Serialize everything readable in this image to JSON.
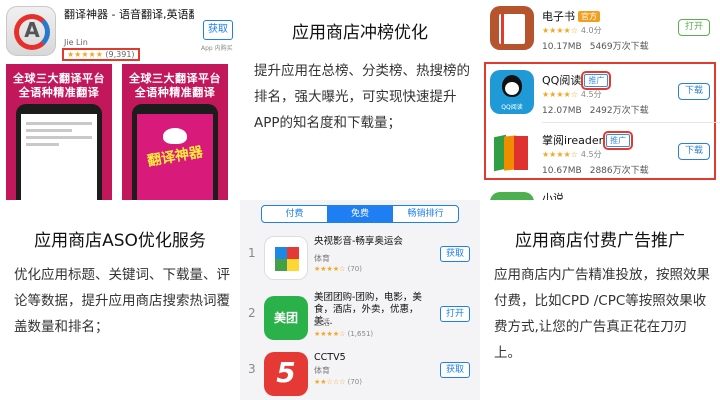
{
  "colors": {
    "accent_red": "#e23b2e",
    "ios_blue": "#1e7ef2",
    "shot_magenta": "#c2185b",
    "star": "#f5a623"
  },
  "app_listing": {
    "title": "翻译神器 - 语音翻译,英语翻译, 日语翻译,韩语翻译,泰语翻译,...",
    "developer": "Jie Lin",
    "rating_stars": "★★★★★",
    "rating_count": "(9,391)",
    "get_label": "获取",
    "iap_label": "App 内购买",
    "screenshots": [
      {
        "headline": "全球三大翻译平台 全语种精准翻译",
        "feature_text": ""
      },
      {
        "headline": "全球三大翻译平台 全语种精准翻译",
        "feature_text": "翻译神器"
      }
    ]
  },
  "section_rank": {
    "title": "应用商店冲榜优化",
    "body": "提升应用在总榜、分类榜、热搜榜的排名，强大曝光，可实现快速提升APP的知名度和下载量；"
  },
  "ad_list": [
    {
      "name": "电子书",
      "tag": "官方",
      "stars": "★★★★☆",
      "score": "4.0分",
      "size": "10.17MB",
      "downloads": "5469万次下载",
      "button": "打开"
    },
    {
      "name": "QQ阅读",
      "tag": "推广",
      "stars": "★★★★☆",
      "score": "4.5分",
      "size": "12.07MB",
      "downloads": "2492万次下载",
      "button": "下载"
    },
    {
      "name": "掌阅ireader",
      "tag": "推广",
      "stars": "★★★★☆",
      "score": "4.5分",
      "size": "10.67MB",
      "downloads": "2886万次下载",
      "button": "下载"
    },
    {
      "name": "小说",
      "tag": "",
      "stars": "",
      "score": "",
      "size": "",
      "downloads": "",
      "button": ""
    }
  ],
  "qq_icon_text": "QQ阅读",
  "section_aso": {
    "title": "应用商店ASO优化服务",
    "body": "优化应用标题、关键词、下载量、评论等数据，提升应用商店搜索热词覆盖数量和排名；"
  },
  "ranking": {
    "tabs": [
      "付费",
      "免费",
      "畅销排行"
    ],
    "active_tab": "免费",
    "items": [
      {
        "rank": "1",
        "name": "央视影音-畅享奥运会",
        "category": "体育",
        "stars": "★★★★☆",
        "reviews": "(70)",
        "button": "获取"
      },
      {
        "rank": "2",
        "name": "美团团购-团购，电影，美食，酒店，外卖，优惠，美...",
        "category": "生活",
        "stars": "★★★★☆",
        "reviews": "(1,651)",
        "button": "打开",
        "icon_text": "美团"
      },
      {
        "rank": "3",
        "name": "CCTV5",
        "category": "体育",
        "stars": "★★☆☆☆",
        "reviews": "(70)",
        "button": "获取",
        "icon_text": "5"
      }
    ]
  },
  "section_ads": {
    "title": "应用商店付费广告推广",
    "body": "应用商店内广告精准投放，按照效果付费，比如CPD /CPC等按照效果收费方式,让您的广告真正花在刀刃上。"
  }
}
